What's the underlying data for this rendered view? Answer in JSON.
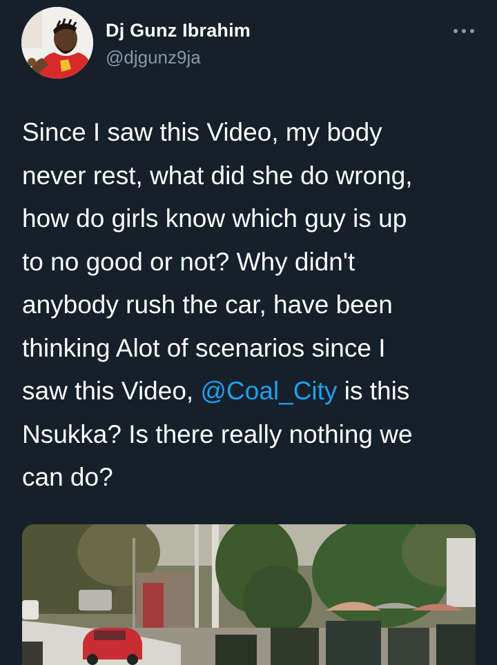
{
  "author": {
    "display_name": "Dj Gunz Ibrahim",
    "handle": "@djgunz9ja",
    "avatar_icon": "user-avatar-photo"
  },
  "more_menu": {
    "icon": "more-horizontal-icon"
  },
  "tweet": {
    "lines": [
      "Since I saw this Video, my body",
      "never rest, what did she do wrong,",
      "how do girls know which guy is up",
      "to no good or not? Why didn't",
      "anybody rush the car, have been",
      "thinking Alot of scenarios since I"
    ],
    "line7_before": "saw this Video, ",
    "mention": "@Coal_City",
    "line7_after": " is this",
    "line8": "Nsukka? Is there really nothing we",
    "line9": "can do?"
  },
  "media": {
    "type": "video-thumbnail",
    "icon": "street-scene-video"
  },
  "colors": {
    "background": "#15202b",
    "text": "#ffffff",
    "secondary_text": "#8899a6",
    "link": "#1da1f2"
  }
}
